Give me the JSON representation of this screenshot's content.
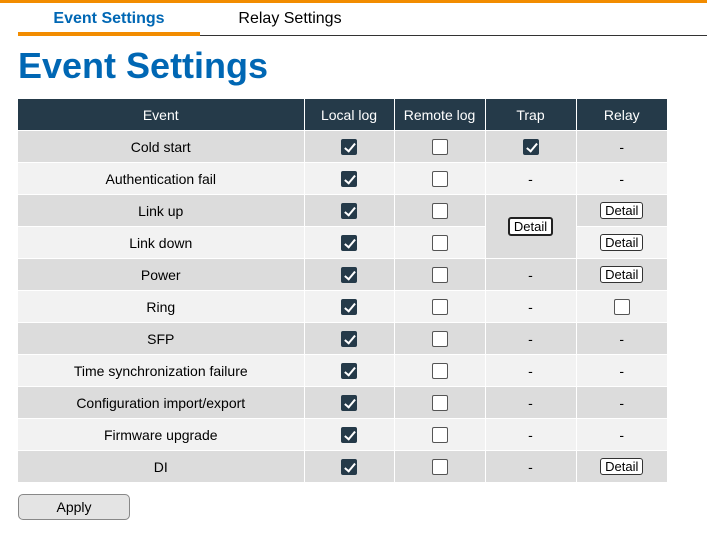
{
  "tabs": {
    "active": "Event Settings",
    "inactive": "Relay Settings"
  },
  "page_title": "Event Settings",
  "table": {
    "headers": [
      "Event",
      "Local log",
      "Remote log",
      "Trap",
      "Relay"
    ],
    "rows": [
      {
        "event": "Cold start",
        "local": true,
        "remote": false,
        "trap": "check",
        "relay": "-"
      },
      {
        "event": "Authentication fail",
        "local": true,
        "remote": false,
        "trap": "-",
        "relay": "-"
      },
      {
        "event": "Link up",
        "local": true,
        "remote": false,
        "trap": "detail-merged",
        "relay": "Detail"
      },
      {
        "event": "Link down",
        "local": true,
        "remote": false,
        "trap": "merged",
        "relay": "Detail"
      },
      {
        "event": "Power",
        "local": true,
        "remote": false,
        "trap": "-",
        "relay": "Detail"
      },
      {
        "event": "Ring",
        "local": true,
        "remote": false,
        "trap": "-",
        "relay": "checkbox-off"
      },
      {
        "event": "SFP",
        "local": true,
        "remote": false,
        "trap": "-",
        "relay": "-"
      },
      {
        "event": "Time synchronization failure",
        "local": true,
        "remote": false,
        "trap": "-",
        "relay": "-"
      },
      {
        "event": "Configuration import/export",
        "local": true,
        "remote": false,
        "trap": "-",
        "relay": "-"
      },
      {
        "event": "Firmware upgrade",
        "local": true,
        "remote": false,
        "trap": "-",
        "relay": "-"
      },
      {
        "event": "DI",
        "local": true,
        "remote": false,
        "trap": "-",
        "relay": "Detail"
      }
    ],
    "detail_label": "Detail",
    "dash": "-"
  },
  "apply_label": "Apply",
  "colors": {
    "accent": "#f28c00",
    "title": "#0067b4",
    "header_bg": "#253a49"
  }
}
